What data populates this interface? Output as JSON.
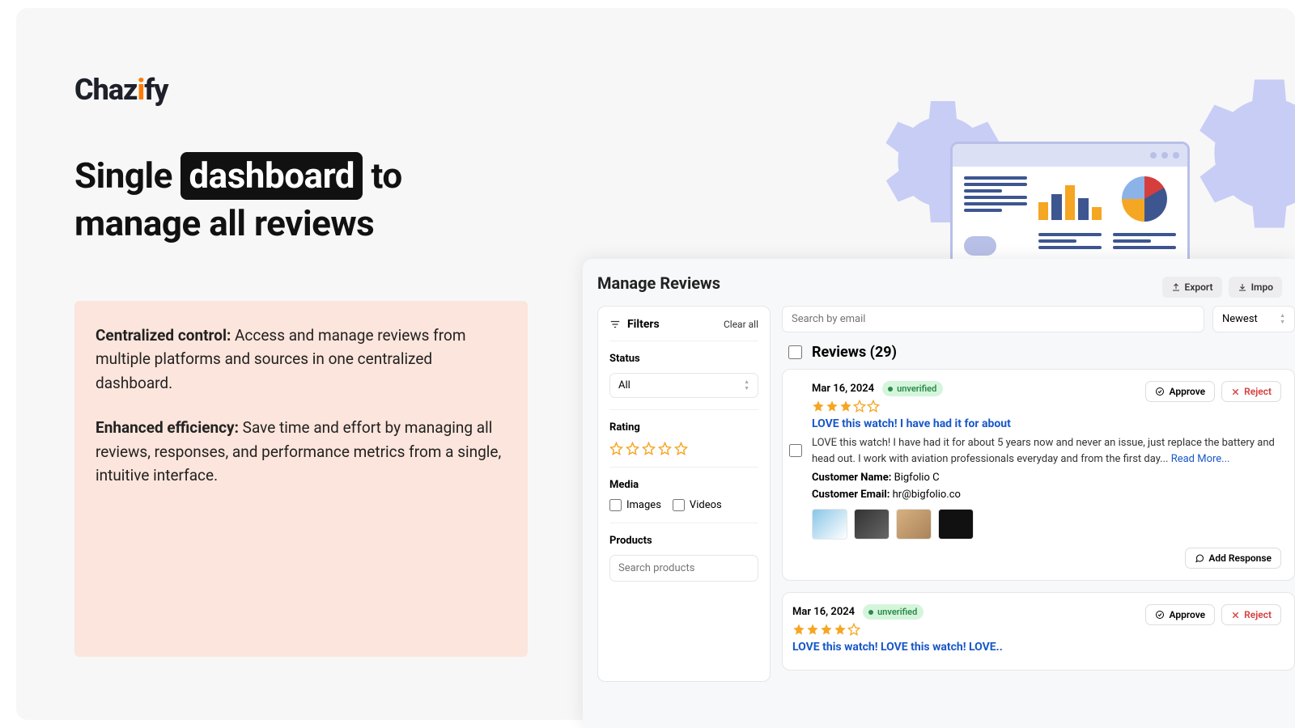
{
  "logo": {
    "text": "Chaz",
    "accent": "i",
    "rest": "fy"
  },
  "headline": {
    "pre": "Single",
    "chip": "dashboard",
    "post": "to manage all reviews"
  },
  "features": [
    {
      "bold": "Centralized control:",
      "text": " Access and manage reviews from multiple platforms and sources in one centralized dashboard."
    },
    {
      "bold": "Enhanced efficiency:",
      "text": " Save time and effort by managing all reviews, responses, and performance metrics from a single, intuitive interface."
    }
  ],
  "app": {
    "title": "Manage Reviews",
    "actions": {
      "export": "Export",
      "import": "Impo"
    },
    "filters": {
      "title": "Filters",
      "clear": "Clear all",
      "status": {
        "label": "Status",
        "value": "All"
      },
      "rating": {
        "label": "Rating"
      },
      "media": {
        "label": "Media",
        "images": "Images",
        "videos": "Videos"
      },
      "products": {
        "label": "Products",
        "placeholder": "Search products"
      }
    },
    "search": {
      "placeholder": "Search by email"
    },
    "sort": {
      "value": "Newest"
    },
    "reviews_header": "Reviews (29)",
    "approve": "Approve",
    "reject": "Reject",
    "add_response": "Add Response",
    "read_more": "Read More...",
    "reviews": [
      {
        "date": "Mar 16, 2024",
        "badge": "unverified",
        "rating": 3,
        "title": "LOVE this watch! I have had it for about",
        "text": "LOVE this watch! I have had it for about 5 years now and never an issue, just replace the battery and head out. I work with aviation professionals everyday and from the first day...",
        "customer_name_lbl": "Customer Name:",
        "customer_name": "Bigfolio C",
        "customer_email_lbl": "Customer Email:",
        "customer_email": "hr@bigfolio.co"
      },
      {
        "date": "Mar 16, 2024",
        "badge": "unverified",
        "rating": 4,
        "title": "LOVE this watch! LOVE this watch! LOVE.."
      }
    ]
  }
}
